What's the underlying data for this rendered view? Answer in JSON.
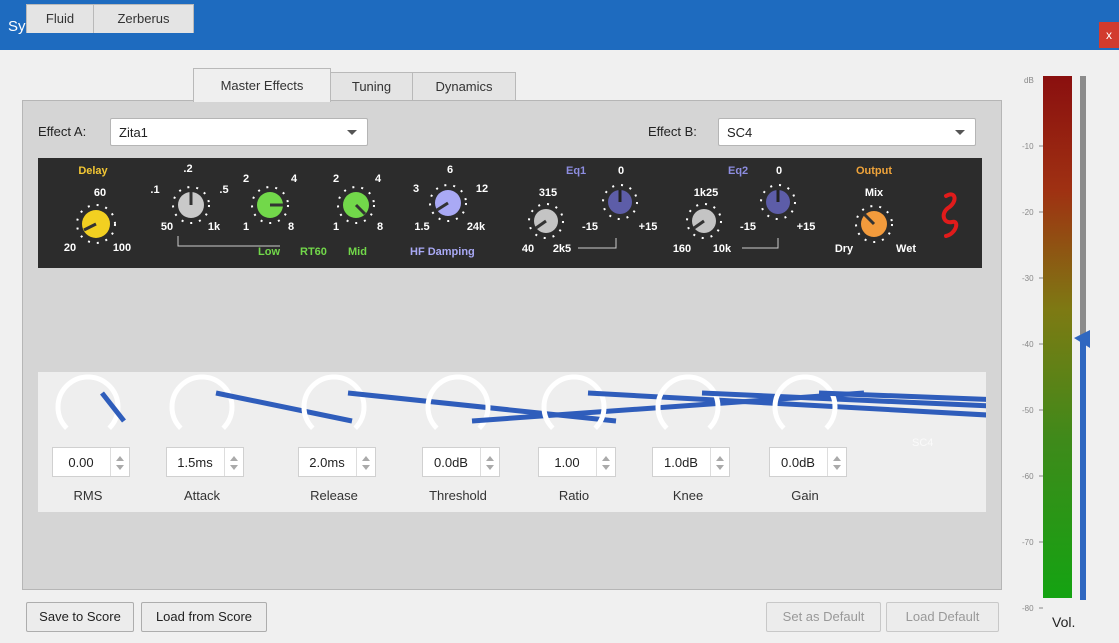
{
  "window": {
    "title": "Synthesizer",
    "close_label": "x"
  },
  "tabs": [
    "Fluid",
    "Zerberus",
    "Master Effects",
    "Tuning",
    "Dynamics"
  ],
  "active_tab": "Master Effects",
  "effect_a": {
    "label": "Effect A:",
    "value": "Zita1"
  },
  "effect_b": {
    "label": "Effect B:",
    "value": "SC4"
  },
  "zita": {
    "delay": {
      "title": "Delay",
      "top": "60",
      "left": "20",
      "right": "100"
    },
    "low_rt60": {
      "top": ".2",
      "left1": ".1",
      "right1": ".5",
      "bottom_left": "50",
      "bottom_right": "1k",
      "color": "#c9c9c9"
    },
    "low": {
      "top_left": "2",
      "top_right": "4",
      "bottom_left": "1",
      "bottom_right": "8"
    },
    "mid": {
      "top_left": "2",
      "top_right": "4",
      "bottom_left": "1",
      "bottom_right": "8"
    },
    "rt60_labels": {
      "low": "Low",
      "rt60": "RT60",
      "mid": "Mid"
    },
    "hf": {
      "top": "6",
      "left": "3",
      "right": "12",
      "bottom_left": "1.5",
      "bottom_right": "24k",
      "label": "HF Damping"
    },
    "eq1": {
      "title": "Eq1",
      "freq_top": "315",
      "freq_left": "40",
      "freq_right": "2k5",
      "gain_top": "0",
      "gain_left": "-15",
      "gain_right": "+15"
    },
    "eq2": {
      "title": "Eq2",
      "freq_top": "1k25",
      "freq_left": "160",
      "freq_right": "10k",
      "gain_top": "0",
      "gain_left": "-15",
      "gain_right": "+15"
    },
    "output": {
      "title": "Output",
      "top": "Mix",
      "left": "Dry",
      "right": "Wet"
    },
    "colors": {
      "yellow": "#f2d021",
      "green": "#72d84a",
      "lavender": "#a9a9f5",
      "gray": "#c4c4c4",
      "purple": "#5d5da8",
      "orange": "#f39b3c",
      "title_yellow": "#f3c734",
      "eq_title": "#8d8de0",
      "output_title": "#f0a43a"
    }
  },
  "sc4": {
    "controls": [
      {
        "name": "RMS",
        "value": "0.00",
        "angle": 45
      },
      {
        "name": "Attack",
        "value": "1.5ms",
        "angle": 45
      },
      {
        "name": "Release",
        "value": "2.0ms",
        "angle": 45
      },
      {
        "name": "Threshold",
        "value": "0.0dB",
        "angle": 135
      },
      {
        "name": "Ratio",
        "value": "1.00",
        "angle": 45
      },
      {
        "name": "Knee",
        "value": "1.0dB",
        "angle": 45
      },
      {
        "name": "Gain",
        "value": "0.0dB",
        "angle": 45
      }
    ],
    "watermark": "SC4"
  },
  "buttons": {
    "save_to_score": "Save to Score",
    "load_from_score": "Load from Score",
    "set_as_default": "Set as Default",
    "load_default": "Load Default"
  },
  "meter": {
    "unit": "dB",
    "ticks": [
      "-10",
      "-20",
      "-30",
      "-40",
      "-50",
      "-60",
      "-70",
      "-80"
    ],
    "volume_label": "Vol.",
    "volume_level_db": -40
  }
}
